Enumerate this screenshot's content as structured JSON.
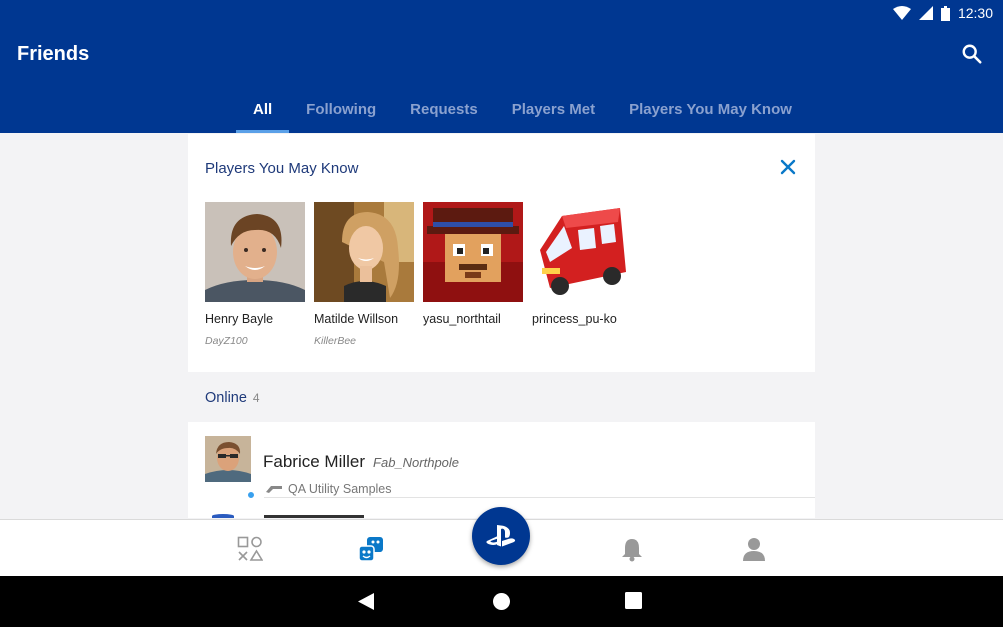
{
  "status": {
    "time": "12:30"
  },
  "header": {
    "title": "Friends"
  },
  "tabs": [
    {
      "label": "All",
      "active": true
    },
    {
      "label": "Following",
      "active": false
    },
    {
      "label": "Requests",
      "active": false
    },
    {
      "label": "Players Met",
      "active": false
    },
    {
      "label": "Players You May Know",
      "active": false
    }
  ],
  "suggestions": {
    "title": "Players You May Know",
    "people": [
      {
        "name": "Henry Bayle",
        "handle": "DayZ100"
      },
      {
        "name": "Matilde Willson",
        "handle": "KillerBee"
      },
      {
        "name": "yasu_northtail",
        "handle": ""
      },
      {
        "name": "princess_pu-ko",
        "handle": ""
      }
    ]
  },
  "online": {
    "label": "Online",
    "count": "4",
    "friends": [
      {
        "name": "Fabrice Miller",
        "handle": "Fab_Northpole",
        "activity": "QA Utility Samples"
      }
    ]
  },
  "icons": {
    "search": "search-icon",
    "close": "close-icon",
    "nav": [
      "playstation-symbols-icon",
      "friends-icon",
      "playstation-icon",
      "bell-icon",
      "profile-icon"
    ],
    "system": [
      "back-icon",
      "home-icon",
      "recents-icon"
    ]
  },
  "colors": {
    "brand": "#003791",
    "accent": "#0a78c8",
    "online": "#39a0ee"
  }
}
